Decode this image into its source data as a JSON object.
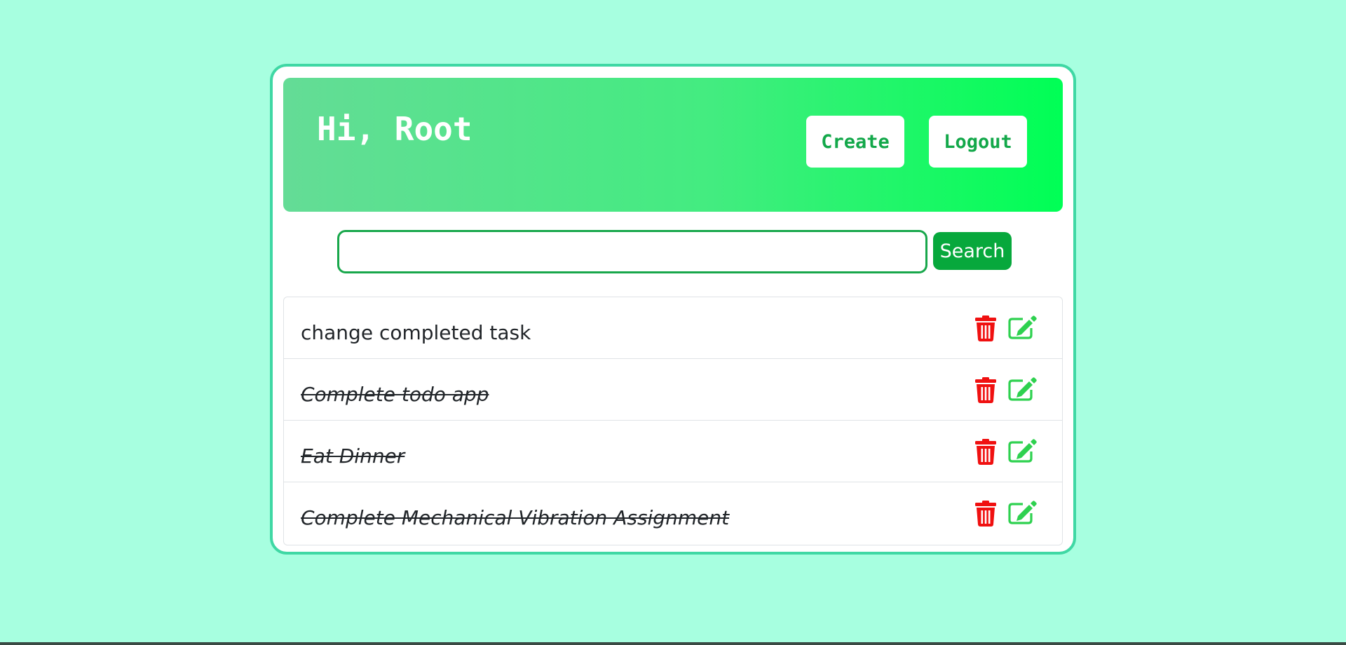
{
  "header": {
    "greeting": "Hi, Root",
    "create_label": "Create",
    "logout_label": "Logout"
  },
  "search": {
    "value": "",
    "button_label": "Search"
  },
  "todos": [
    {
      "text": "change completed task",
      "completed": false
    },
    {
      "text": "Complete todo app",
      "completed": true
    },
    {
      "text": "Eat Dinner",
      "completed": true
    },
    {
      "text": "Complete Mechanical Vibration Assignment",
      "completed": true
    }
  ],
  "icons": {
    "delete": "trash-icon",
    "edit": "pencil-square-icon"
  },
  "colors": {
    "background": "#a7ffe0",
    "card_border": "#3fd8a4",
    "header_gradient_start": "#64dc96",
    "header_gradient_end": "#00ff55",
    "accent_green": "#13a84a",
    "delete_red": "#f01010",
    "edit_green": "#2ed14f"
  }
}
